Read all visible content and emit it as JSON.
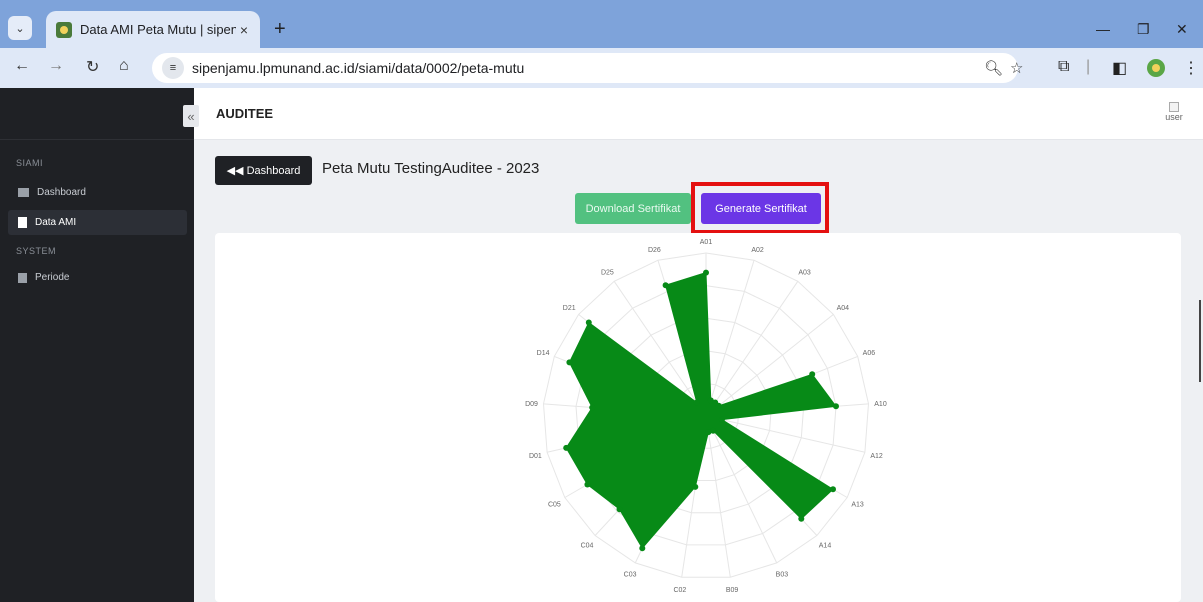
{
  "browser": {
    "tab_title": "Data AMI Peta Mutu | sipenjamu",
    "tab_close": "×",
    "new_tab": "+",
    "url": "sipenjamu.lpmunand.ac.id/siami/data/0002/peta-mutu",
    "icons": [
      "menu-chevron-icon",
      "favicon-icon",
      "back-arrow-icon",
      "forward-arrow-icon",
      "reload-icon",
      "home-icon",
      "site-settings-icon",
      "zoom-icon",
      "star-icon",
      "extensions-icon",
      "sidepanel-icon",
      "profile-icon",
      "more-icon"
    ]
  },
  "sidebar": {
    "collapse": "«",
    "sections": [
      {
        "label": "SIAMI",
        "items": [
          {
            "label": "Dashboard",
            "active": false
          },
          {
            "label": "Data AMI",
            "active": true
          }
        ]
      },
      {
        "label": "SYSTEM",
        "items": [
          {
            "label": "Periode",
            "active": false
          }
        ]
      }
    ]
  },
  "header": {
    "title": "AUDITEE",
    "user_alt": "user"
  },
  "main": {
    "back_label": "◀◀ Dashboard",
    "page_title": "Peta Mutu TestingAuditee - 2023",
    "download_label": "Download Sertifikat",
    "generate_label": "Generate Sertifikat"
  },
  "colors": {
    "accent": "#6b36e6",
    "download": "#52c180",
    "series": "#078a17",
    "highlight": "#e41010"
  },
  "chart_data": {
    "type": "radar",
    "categories": [
      "A01",
      "A02",
      "A03",
      "A04",
      "A06",
      "A10",
      "A12",
      "A13",
      "A14",
      "B03",
      "B09",
      "C02",
      "C03",
      "C04",
      "C05",
      "D01",
      "D09",
      "D14",
      "D21",
      "D25",
      "D26"
    ],
    "series": [
      {
        "values": [
          4.4,
          0.5,
          0.5,
          0.5,
          3.5,
          4.0,
          0.5,
          4.5,
          4.3,
          0.5,
          0.5,
          2.2,
          4.5,
          3.9,
          4.2,
          4.4,
          3.5,
          4.5,
          4.6,
          0.5,
          4.2
        ]
      }
    ],
    "rlim": [
      0,
      5
    ],
    "grid": true,
    "legend": "none"
  }
}
